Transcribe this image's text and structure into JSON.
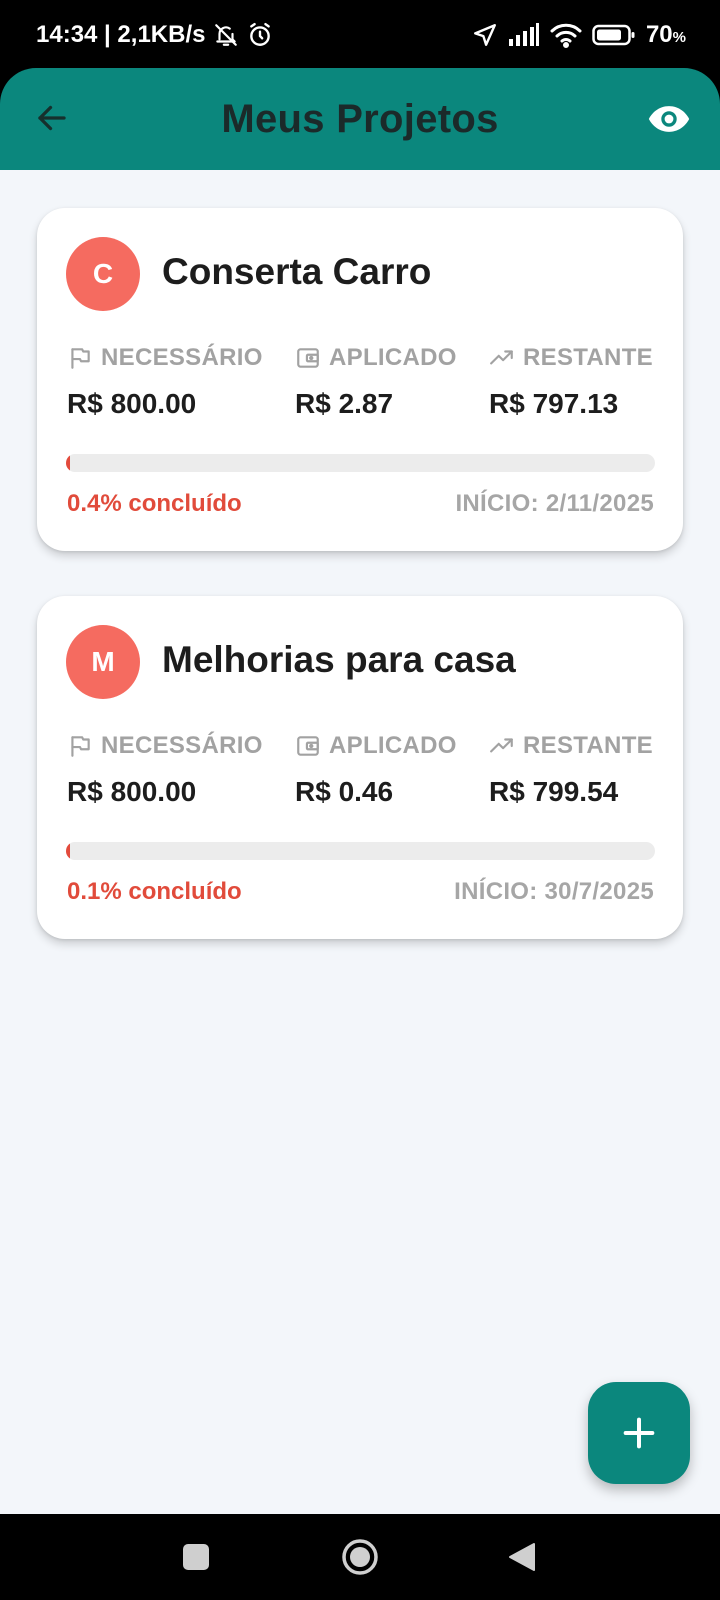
{
  "status_bar": {
    "time_speed": "14:34 | 2,1KB/s",
    "battery_percent": "70",
    "battery_unit": "%",
    "icons": [
      "bell-off-icon",
      "alarm-icon",
      "location-arrow-icon",
      "signal-icon",
      "wifi-icon",
      "battery-icon"
    ]
  },
  "app_bar": {
    "title": "Meus Projetos",
    "back_icon": "arrow-left-icon",
    "visibility_icon": "eye-icon"
  },
  "labels": {
    "required": "NECESSÁRIO",
    "applied": "APLICADO",
    "remaining": "RESTANTE"
  },
  "projects": [
    {
      "initial": "C",
      "name": "Conserta Carro",
      "required": "R$ 800.00",
      "applied": "R$ 2.87",
      "remaining": "R$ 797.13",
      "progress_percent": 0.4,
      "progress_text": "0.4% concluído",
      "start_text": "INÍCIO: 2/11/2025"
    },
    {
      "initial": "M",
      "name": "Melhorias para casa",
      "required": "R$ 800.00",
      "applied": "R$ 0.46",
      "remaining": "R$ 799.54",
      "progress_percent": 0.1,
      "progress_text": "0.1% concluído",
      "start_text": "INÍCIO: 30/7/2025"
    }
  ],
  "fab": {
    "icon": "plus-icon"
  },
  "colors": {
    "primary": "#0b877d",
    "avatar": "#f56b60",
    "progress": "#e34a3c",
    "background": "#f3f6fa"
  }
}
